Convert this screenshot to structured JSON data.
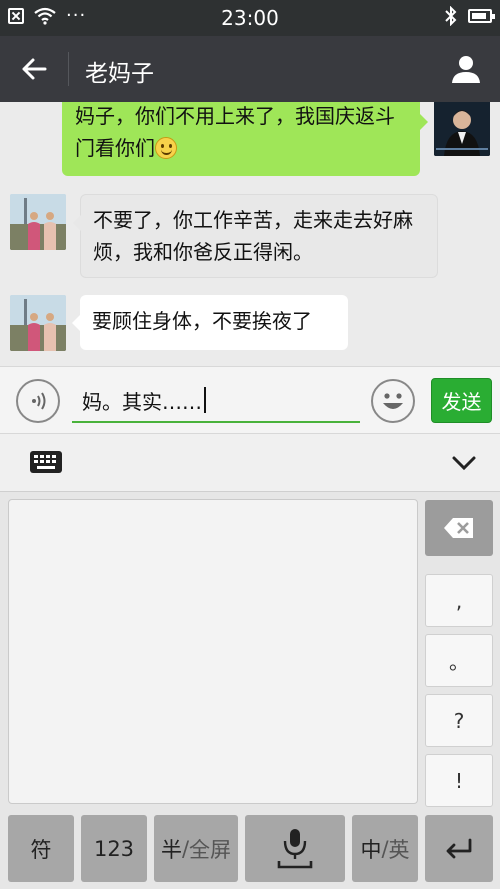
{
  "status_bar": {
    "time": "23:00"
  },
  "header": {
    "title": "老妈子"
  },
  "messages": [
    {
      "from": "self",
      "text": "妈子，你们不用上来了，我国庆返斗门看你们",
      "emoji": "smiley-icon"
    },
    {
      "from": "other",
      "text": "不要了，你工作辛苦，走来走去好麻烦，我和你爸反正得闲。"
    },
    {
      "from": "other",
      "text": "要顾住身体，不要挨夜了"
    }
  ],
  "input": {
    "value": "妈。其实……",
    "send_label": "发送"
  },
  "keyboard": {
    "punctuation": [
      ",",
      "。",
      "?",
      "!"
    ],
    "bottom_keys": {
      "symbols": "符",
      "numbers": "123",
      "half": "半",
      "slash1": "/",
      "full": "全屏",
      "chinese": "中",
      "slash2": "/",
      "english": "英"
    }
  },
  "colors": {
    "accent": "#2aad33",
    "bubble_out": "#9fe658",
    "title_bar": "#393a3f"
  }
}
